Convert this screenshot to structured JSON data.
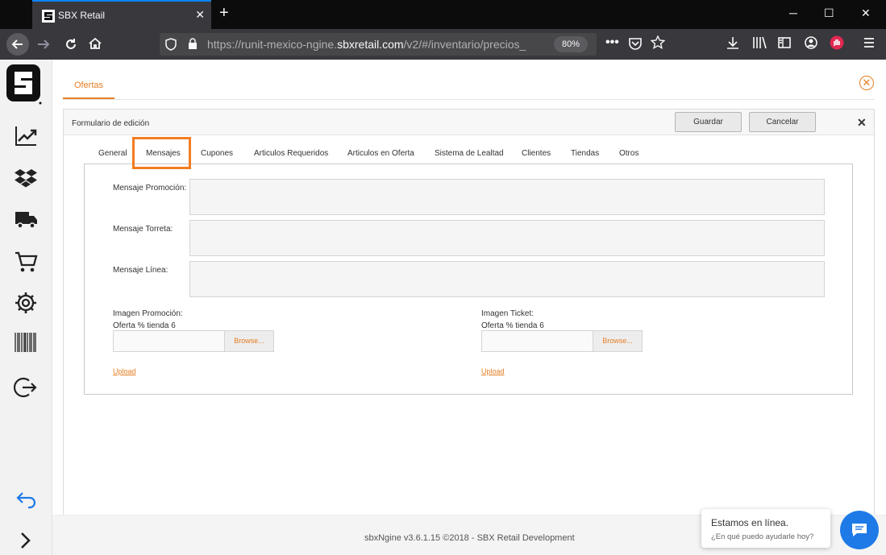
{
  "browser": {
    "tab_title": "SBX Retail",
    "new_tab": "+",
    "url_prefix": "https://runit-mexico-ngine.",
    "url_domain": "sbxretail.com",
    "url_path": "/v2/#/inventario/precios_",
    "zoom": "80%"
  },
  "page": {
    "top_tab": "Ofertas",
    "form_title": "Formulario de edición",
    "save_button": "Guardar",
    "cancel_button": "Cancelar",
    "tabs": [
      "General",
      "Mensajes",
      "Cupones",
      "Articulos Requeridos",
      "Articulos en Oferta",
      "Sistema de Lealtad",
      "Clientes",
      "Tiendas",
      "Otros"
    ],
    "active_tab": "Mensajes",
    "fields": {
      "promo_label": "Mensaje Promoción:",
      "torreta_label": "Mensaje Torreta:",
      "linea_label": "Mensaje Línea:",
      "promo_value": "",
      "torreta_value": "",
      "linea_value": ""
    },
    "image_promo": {
      "label": "Imagen Promoción:",
      "subtitle": "Oferta % tienda 6",
      "browse": "Browse...",
      "upload": "Upload"
    },
    "image_ticket": {
      "label": "Imagen Ticket:",
      "subtitle": "Oferta % tienda 6",
      "browse": "Browse...",
      "upload": "Upload"
    }
  },
  "footer": {
    "text": "sbxNgine v3.6.1.15 ©2018 - SBX Retail Development"
  },
  "chat": {
    "title": "Estamos en línea.",
    "subtitle": "¿En qué puedo ayudarle hoy?"
  },
  "colors": {
    "accent": "#e67e22",
    "highlight": "#f47c20",
    "chat": "#1e7ae6"
  }
}
